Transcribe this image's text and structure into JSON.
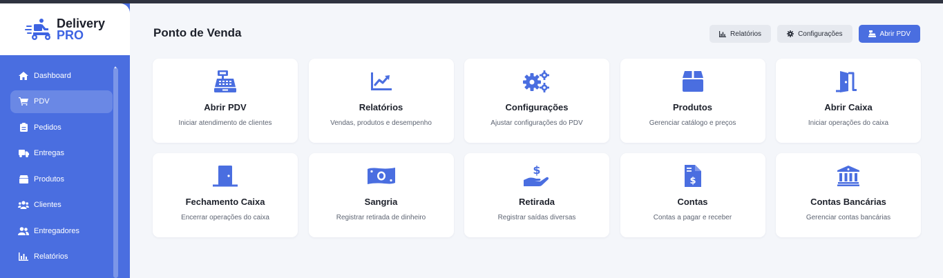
{
  "brand": {
    "line1": "Delivery",
    "line2": "PRO",
    "accent": "#3d63e2"
  },
  "colors": {
    "sidebar": "#4a6ee0",
    "primary": "#4a6ee0",
    "icon": "#4a6ee0"
  },
  "sidebar": {
    "items": [
      {
        "label": "Dashboard",
        "icon": "home-icon"
      },
      {
        "label": "PDV",
        "icon": "cart-icon",
        "active": true
      },
      {
        "label": "Pedidos",
        "icon": "clipboard-icon"
      },
      {
        "label": "Entregas",
        "icon": "truck-icon"
      },
      {
        "label": "Produtos",
        "icon": "box-icon"
      },
      {
        "label": "Clientes",
        "icon": "users-icon"
      },
      {
        "label": "Entregadores",
        "icon": "user-group-icon"
      },
      {
        "label": "Relatórios",
        "icon": "chart-icon"
      }
    ]
  },
  "header": {
    "title": "Ponto de Venda",
    "buttons": {
      "reports": "Relatórios",
      "settings": "Configurações",
      "open_pdv": "Abrir PDV"
    }
  },
  "cards": [
    {
      "title": "Abrir PDV",
      "desc": "Iniciar atendimento de clientes",
      "icon": "cash-register-icon"
    },
    {
      "title": "Relatórios",
      "desc": "Vendas, produtos e desempenho",
      "icon": "chart-line-icon"
    },
    {
      "title": "Configurações",
      "desc": "Ajustar configurações do PDV",
      "icon": "gears-icon"
    },
    {
      "title": "Produtos",
      "desc": "Gerenciar catálogo e preços",
      "icon": "box-icon"
    },
    {
      "title": "Abrir Caixa",
      "desc": "Iniciar operações do caixa",
      "icon": "door-open-icon"
    },
    {
      "title": "Fechamento Caixa",
      "desc": "Encerrar operações do caixa",
      "icon": "door-closed-icon"
    },
    {
      "title": "Sangria",
      "desc": "Registrar retirada de dinheiro",
      "icon": "money-bill-icon"
    },
    {
      "title": "Retirada",
      "desc": "Registrar saídas diversas",
      "icon": "hand-dollar-icon"
    },
    {
      "title": "Contas",
      "desc": "Contas a pagar e receber",
      "icon": "invoice-dollar-icon"
    },
    {
      "title": "Contas Bancárias",
      "desc": "Gerenciar contas bancárias",
      "icon": "bank-icon"
    }
  ]
}
